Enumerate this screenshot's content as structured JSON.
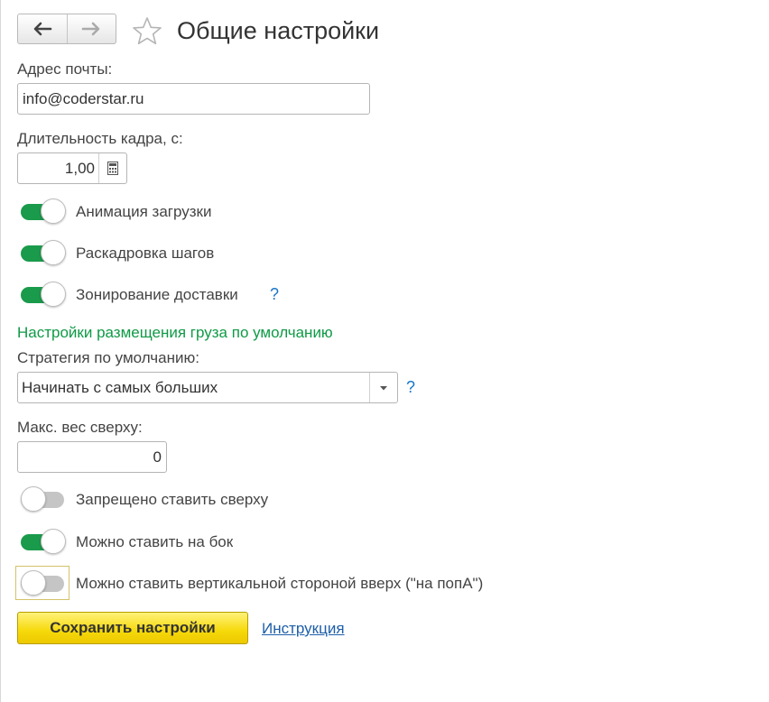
{
  "header": {
    "title": "Общие настройки",
    "back_icon": "arrow-left-icon",
    "forward_icon": "arrow-right-icon",
    "favorite_icon": "star-icon"
  },
  "email": {
    "label": "Адрес почты:",
    "value": "info@coderstar.ru"
  },
  "frame_duration": {
    "label": "Длительность кадра, с:",
    "value": "1,00",
    "icon": "calculator-icon"
  },
  "toggles_top": [
    {
      "label": "Анимация загрузки",
      "on": true
    },
    {
      "label": "Раскадровка шагов",
      "on": true
    },
    {
      "label": "Зонирование доставки",
      "on": true,
      "help": "?"
    }
  ],
  "cargo": {
    "section_title": "Настройки размещения груза по умолчанию",
    "strategy_label": "Стратегия по умолчанию:",
    "strategy_value": "Начинать с самых больших",
    "strategy_help": "?",
    "max_weight_label": "Макс. вес сверху:",
    "max_weight_value": "0"
  },
  "toggles_bottom": [
    {
      "label": "Запрещено ставить сверху",
      "on": false
    },
    {
      "label": "Можно ставить на бок",
      "on": true
    },
    {
      "label": "Можно ставить вертикальной стороной вверх (\"на попА\")",
      "on": false
    }
  ],
  "actions": {
    "save_label": "Сохранить настройки",
    "help_link": "Инструкция"
  },
  "colors": {
    "toggle_on": "#1a9a4b",
    "section_green": "#0e9a45",
    "save_yellow": "#f6d90a",
    "link_blue": "#1d5ea8"
  }
}
